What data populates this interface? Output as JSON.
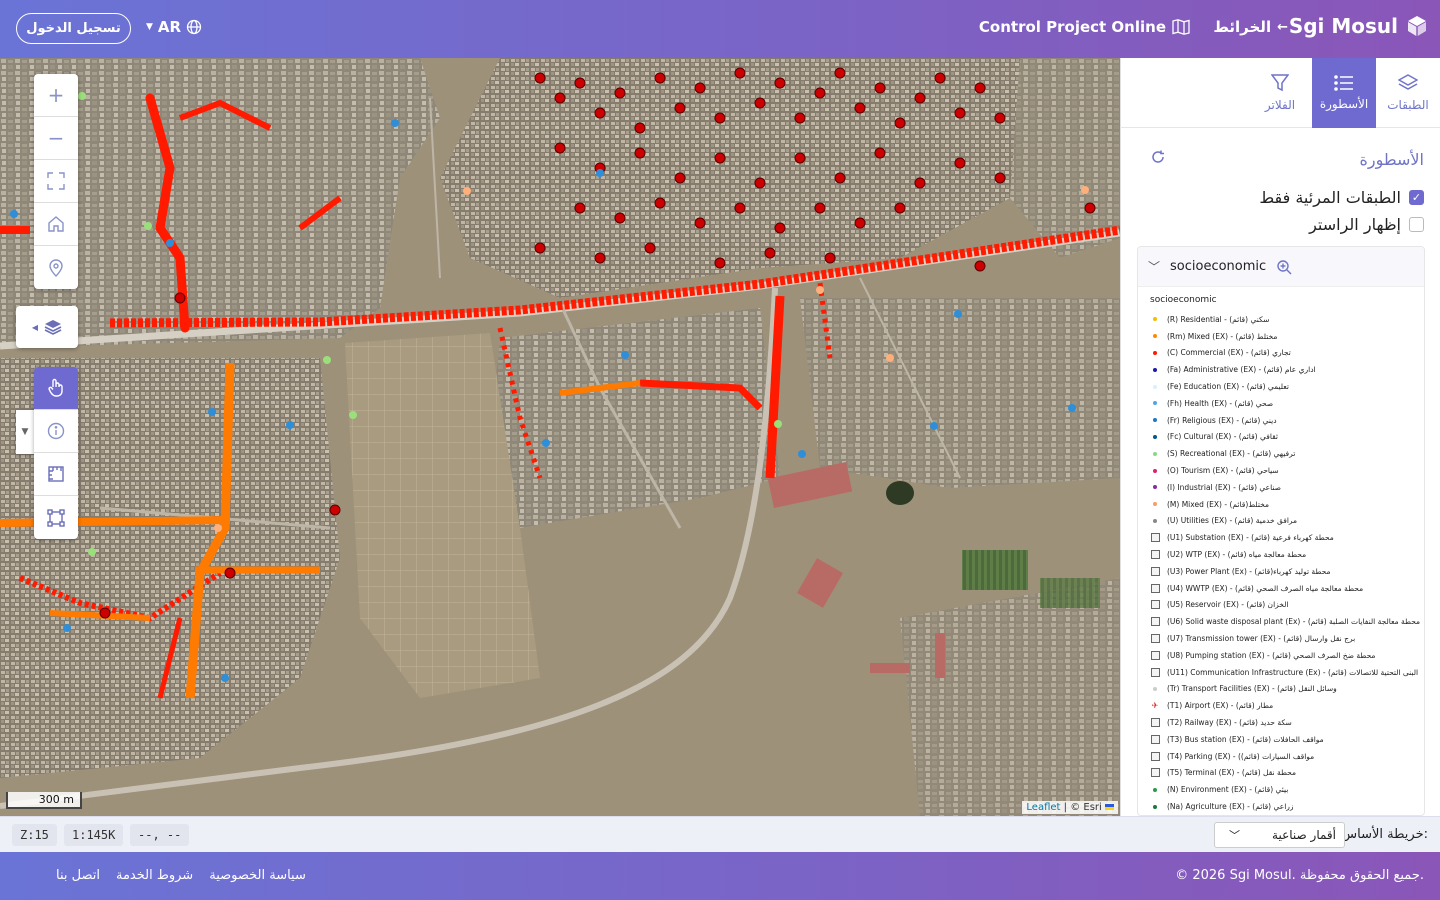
{
  "header": {
    "brand": "Sgi Mosul",
    "maps_link": "الخرائط",
    "project_link": "Control Project Online",
    "language": "AR",
    "login": "تسجيل الدخول"
  },
  "map": {
    "controls": [
      "zoom-in-icon",
      "zoom-out-icon",
      "fullscreen-icon",
      "home-icon",
      "location-icon"
    ],
    "tools": [
      "pointer-icon",
      "info-icon",
      "measure-icon",
      "select-box-icon"
    ],
    "scale": "300 m",
    "attribution_leaflet": "Leaflet",
    "attribution_esri": "| © Esri",
    "colors": {
      "red": "#ff1a00",
      "orange": "#ff7a00",
      "dark_red": "#b40000",
      "accent": "#6f6ad0"
    }
  },
  "panel": {
    "tabs": [
      {
        "label": "الطبقات",
        "icon": "layers-icon"
      },
      {
        "label": "الأسطورة",
        "icon": "list-icon"
      },
      {
        "label": "الفلاتر",
        "icon": "filter-icon"
      }
    ],
    "title": "الأسطورة",
    "visible_only": "الطبقات المرئية فقط",
    "show_raster": "إظهار الراستر",
    "group": "socioeconomic",
    "legend_subtitle": "socioeconomic",
    "legend": [
      {
        "label": "(R) Residential - (قائم) سكني",
        "sym": "dot",
        "color": "#f2c000"
      },
      {
        "label": "(Rm) Mixed (EX) -  مختلط (قائم)",
        "sym": "dot",
        "color": "#ff8a00"
      },
      {
        "label": "(C) Commercial (EX) - تجاري (قائم)",
        "sym": "dot",
        "color": "#ff1a00"
      },
      {
        "label": "(Fa) Administrative (EX) - اداري عام (قائم)",
        "sym": "dot",
        "color": "#1a1aa8"
      },
      {
        "label": "(Fe) Education (EX) - تعليمي (قائم)",
        "sym": "dot",
        "color": "#d8f0ff"
      },
      {
        "label": "(Fh) Health (EX) - صحي (قائم)",
        "sym": "dot",
        "color": "#4aa8e8"
      },
      {
        "label": "(Fr) Religious (EX) - ديني (قائم)",
        "sym": "dot",
        "color": "#1a78c8"
      },
      {
        "label": "(Fc) Cultural (EX) - ثقافي (قائم)",
        "sym": "dot",
        "color": "#005a8a"
      },
      {
        "label": "(S) Recreational (EX) -  ترفيهي (قائم)",
        "sym": "dot",
        "color": "#8ad88a"
      },
      {
        "label": "(O) Tourism (EX) - سياحي (قائم)",
        "sym": "dot",
        "color": "#e0206a"
      },
      {
        "label": "(I) Industrial (EX) - صناعي (قائم)",
        "sym": "dot",
        "color": "#8a2aa0"
      },
      {
        "label": "(M) Mixed (EX) - مختلط(قائم)",
        "sym": "dot",
        "color": "#ff9a60"
      },
      {
        "label": "(U) Utilities (EX) - مرافق خدمية (قائم)",
        "sym": "dot",
        "color": "#888888"
      },
      {
        "label": "(U1) Substation (EX) - محطة كهرباء فرعية (قائم)",
        "sym": "box"
      },
      {
        "label": "(U2) WTP (EX) - محطة معالجة مياه (قائم)",
        "sym": "box"
      },
      {
        "label": "(U3) Power Plant (Ex) - محطة توليد كهرباء(قائم)",
        "sym": "box"
      },
      {
        "label": "(U4) WWTP (EX) - محطة معالجة مياه الصرف الصحي (قائم)",
        "sym": "box"
      },
      {
        "label": "(U5) Reservoir (EX) - الخزان (قائم)",
        "sym": "box"
      },
      {
        "label": "(U6) Solid waste disposal plant (Ex) - محطة معالجة النفايات الصلبة (قائم)",
        "sym": "box"
      },
      {
        "label": "(U7) Transmission tower (EX) - برج نقل وارسال (قائم)",
        "sym": "box"
      },
      {
        "label": "(U8) Pumping station (EX) - محطة ضخ الصرف الصحي (قائم)",
        "sym": "box"
      },
      {
        "label": "(U11) Communication Infrastructure (Ex) - البنى التحتية للاتصالات (قائم)",
        "sym": "box"
      },
      {
        "label": "(Tr) Transport Facilities (EX) - وسائل النقل (قائم)",
        "sym": "dot",
        "color": "#cccccc"
      },
      {
        "label": "(T1) Airport (EX) - مطار (قائم)",
        "sym": "plane"
      },
      {
        "label": "(T2) Railway (EX) - سكة حديد (قائم)",
        "sym": "box"
      },
      {
        "label": "(T3) Bus station (EX) - مواقف الحافلات (قائم)",
        "sym": "box"
      },
      {
        "label": "(T4) Parking (EX) - (مواقف السيارات (قائم)",
        "sym": "box"
      },
      {
        "label": "(T5) Terminal (EX) - محطة نقل (قائم)",
        "sym": "box"
      },
      {
        "label": "(N) Environment (EX) - بيئي (قائم)",
        "sym": "dot",
        "color": "#2a9a4a"
      },
      {
        "label": "(Na) Agriculture (EX) - زراعي (قائم)",
        "sym": "dot",
        "color": "#1a7a3a"
      }
    ]
  },
  "status": {
    "zoom": "Z:15",
    "scale": "1:145K",
    "coords": "--, --",
    "basemap_label": "خريطة الأساس:",
    "basemap_value": "أقمار صناعية"
  },
  "footer": {
    "copyright": "© 2026 Sgi Mosul. جميع الحقوق محفوظة.",
    "privacy": "سياسة الخصوصية",
    "terms": "شروط الخدمة",
    "contact": "اتصل بنا"
  }
}
